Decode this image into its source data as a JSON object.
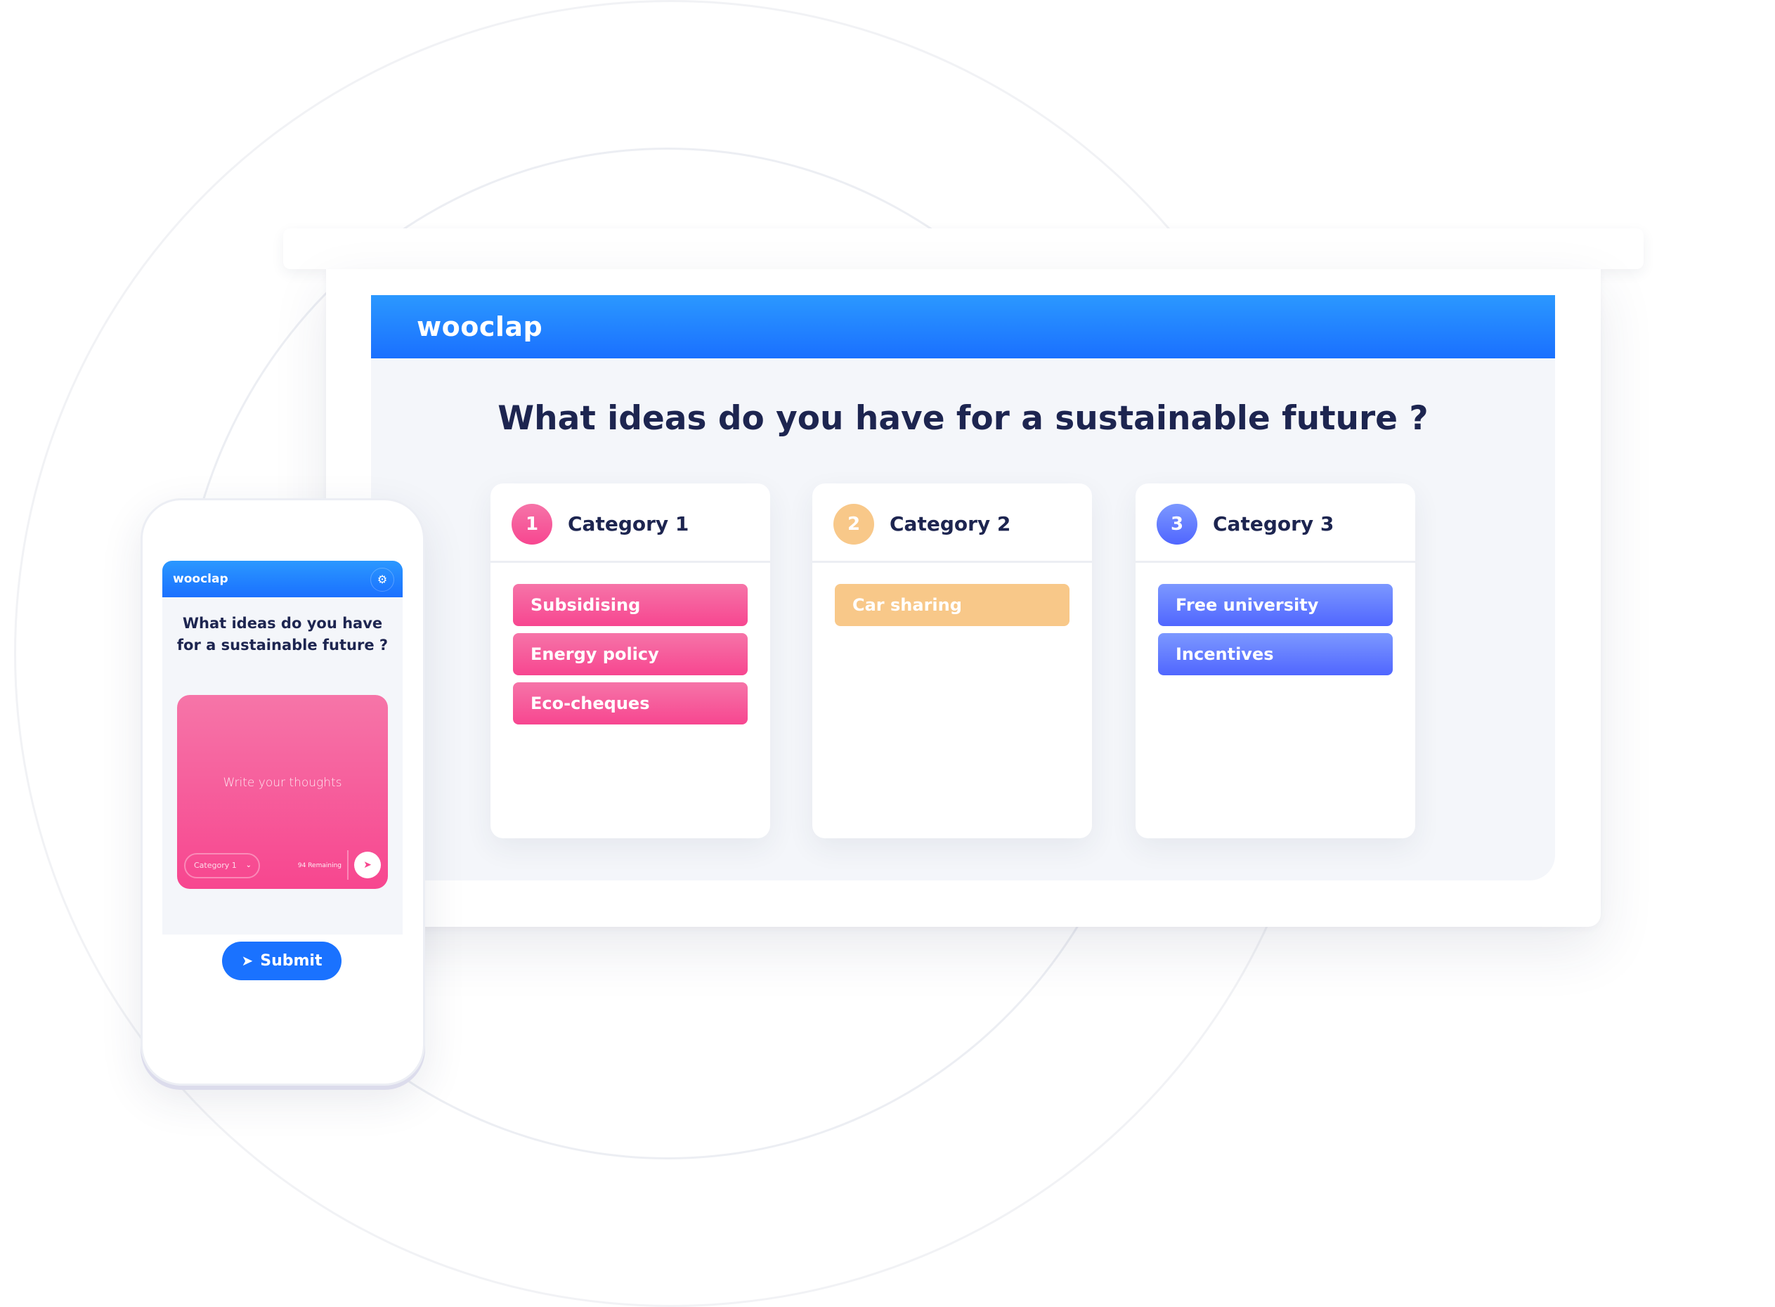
{
  "brand": "wooclap",
  "colors": {
    "header_blue": "#1a70ff",
    "category_1": "#f74690",
    "category_2": "#f8c889",
    "category_3": "#5066ff",
    "title_text": "#1d2550"
  },
  "presentation": {
    "logo": "wooclap",
    "question": "What ideas do you have for a sustainable future ?",
    "categories": [
      {
        "number": "1",
        "title": "Category 1",
        "color": "pink",
        "ideas": [
          "Subsidising",
          "Energy policy",
          "Eco-cheques"
        ]
      },
      {
        "number": "2",
        "title": "Category 2",
        "color": "orange",
        "ideas": [
          "Car sharing"
        ]
      },
      {
        "number": "3",
        "title": "Category 3",
        "color": "blue",
        "ideas": [
          "Free university",
          "Incentives"
        ]
      }
    ]
  },
  "phone": {
    "logo": "wooclap",
    "settings_icon": "gear-icon",
    "question": "What ideas do you have for a sustainable future ?",
    "input_placeholder": "Write your thoughts",
    "category_select": "Category 1",
    "remaining": "94 Remaining",
    "send_icon": "paper-plane-icon",
    "submit_label": "Submit"
  }
}
